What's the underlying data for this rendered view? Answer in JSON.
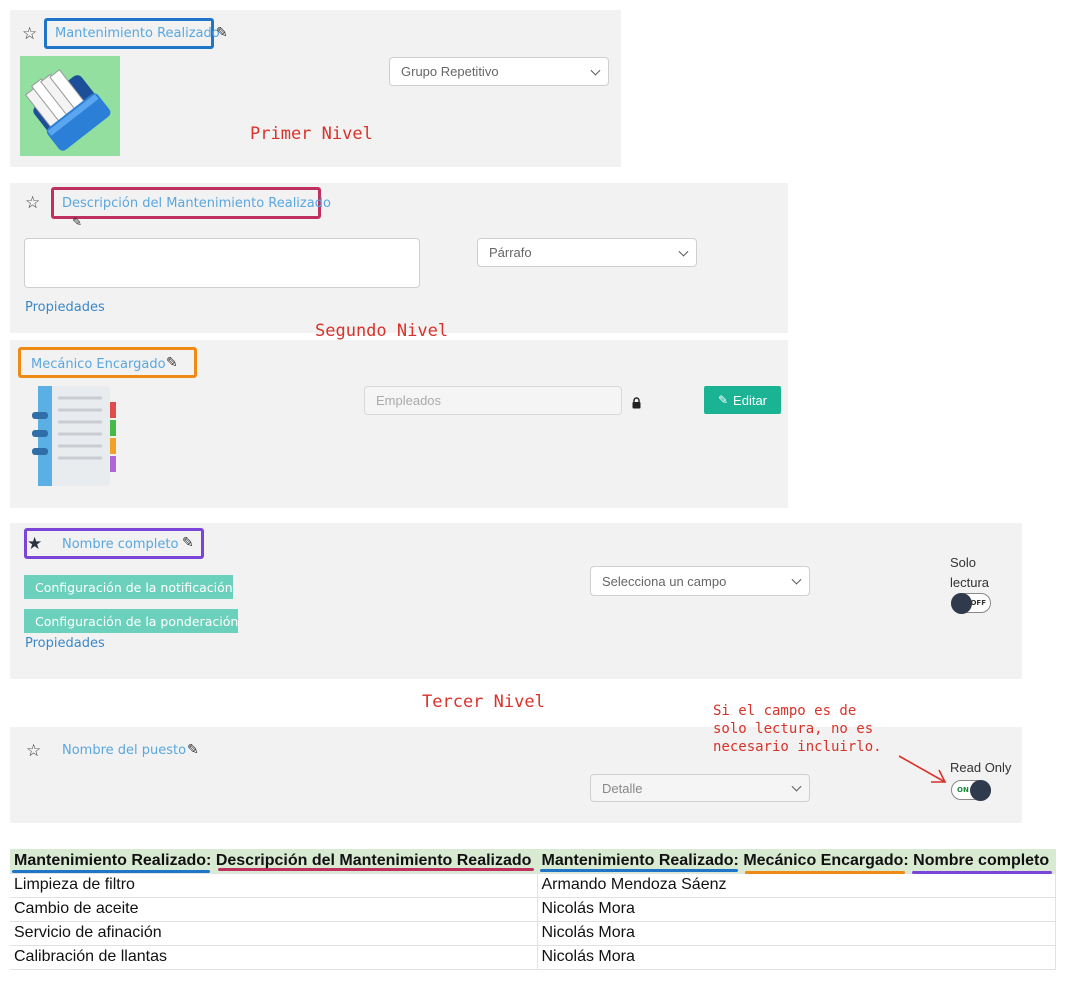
{
  "level1": {
    "field_label": "Mantenimiento Realizado",
    "select_value": "Grupo Repetitivo",
    "annotation": "Primer Nivel"
  },
  "level2": {
    "description_label": "Descripción del Mantenimiento Realizado",
    "select_value": "Párrafo",
    "properties_link": "Propiedades",
    "annotation": "Segundo Nivel",
    "mechanic_label": "Mecánico Encargado",
    "employees_placeholder": "Empleados",
    "edit_button": "Editar"
  },
  "level3": {
    "name_label": "Nombre completo",
    "notification_button": "Configuración de la notificación",
    "weighting_button": "Configuración de la ponderación",
    "properties_link": "Propiedades",
    "select_placeholder": "Selecciona un campo",
    "readonly_label_line1": "Solo",
    "readonly_label_line2": "lectura",
    "toggle_off": "OFF",
    "annotation": "Tercer Nivel",
    "note_line1": "Si el campo es de",
    "note_line2": "solo lectura, no es",
    "note_line3": "necesario incluirlo.",
    "position_label": "Nombre del puesto",
    "position_select": "Detalle",
    "read_only_label": "Read Only",
    "toggle_on": "ON"
  },
  "sheet": {
    "headers": [
      [
        "Mantenimiento Realizado:",
        "Descripción del Mantenimiento Realizado"
      ],
      [
        "Mantenimiento Realizado:",
        "Mecánico Encargado:",
        "Nombre completo"
      ]
    ],
    "rows": [
      [
        "Limpieza de filtro",
        "Armando Mendoza Sáenz"
      ],
      [
        "Cambio de aceite",
        "Nicolás Mora"
      ],
      [
        "Servicio de afinación",
        "Nicolás Mora"
      ],
      [
        "Calibración de llantas",
        "Nicolás Mora"
      ]
    ]
  },
  "colors": {
    "level1_box": "#1f75c7",
    "description_box": "#c0305e",
    "mechanic_box": "#ef8a14",
    "name_box": "#7a45d8",
    "annotation_text": "#d8322a",
    "teal": "#1ab394",
    "header_bg": "#d9ead3"
  }
}
